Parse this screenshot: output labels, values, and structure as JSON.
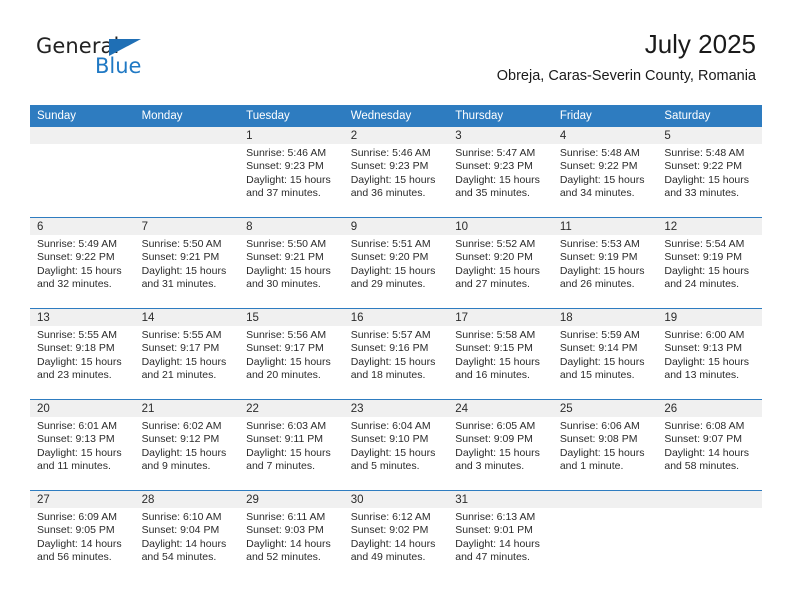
{
  "brand": {
    "name_top": "General",
    "name_bottom": "Blue",
    "triangle_icon": "triangle-icon",
    "color_blue": "#2079c4",
    "color_dark": "#222222"
  },
  "header": {
    "title": "July 2025",
    "subtitle": "Obreja, Caras-Severin County, Romania"
  },
  "theme": {
    "header_blue": "#2e7cc0",
    "daynum_band": "#f0f0f0",
    "text": "#2b2b2b"
  },
  "weekdays": [
    "Sunday",
    "Monday",
    "Tuesday",
    "Wednesday",
    "Thursday",
    "Friday",
    "Saturday"
  ],
  "weeks": [
    [
      {
        "day": "",
        "sunrise": "",
        "sunset": "",
        "daylight": ""
      },
      {
        "day": "",
        "sunrise": "",
        "sunset": "",
        "daylight": ""
      },
      {
        "day": "1",
        "sunrise": "Sunrise: 5:46 AM",
        "sunset": "Sunset: 9:23 PM",
        "daylight": "Daylight: 15 hours and 37 minutes."
      },
      {
        "day": "2",
        "sunrise": "Sunrise: 5:46 AM",
        "sunset": "Sunset: 9:23 PM",
        "daylight": "Daylight: 15 hours and 36 minutes."
      },
      {
        "day": "3",
        "sunrise": "Sunrise: 5:47 AM",
        "sunset": "Sunset: 9:23 PM",
        "daylight": "Daylight: 15 hours and 35 minutes."
      },
      {
        "day": "4",
        "sunrise": "Sunrise: 5:48 AM",
        "sunset": "Sunset: 9:22 PM",
        "daylight": "Daylight: 15 hours and 34 minutes."
      },
      {
        "day": "5",
        "sunrise": "Sunrise: 5:48 AM",
        "sunset": "Sunset: 9:22 PM",
        "daylight": "Daylight: 15 hours and 33 minutes."
      }
    ],
    [
      {
        "day": "6",
        "sunrise": "Sunrise: 5:49 AM",
        "sunset": "Sunset: 9:22 PM",
        "daylight": "Daylight: 15 hours and 32 minutes."
      },
      {
        "day": "7",
        "sunrise": "Sunrise: 5:50 AM",
        "sunset": "Sunset: 9:21 PM",
        "daylight": "Daylight: 15 hours and 31 minutes."
      },
      {
        "day": "8",
        "sunrise": "Sunrise: 5:50 AM",
        "sunset": "Sunset: 9:21 PM",
        "daylight": "Daylight: 15 hours and 30 minutes."
      },
      {
        "day": "9",
        "sunrise": "Sunrise: 5:51 AM",
        "sunset": "Sunset: 9:20 PM",
        "daylight": "Daylight: 15 hours and 29 minutes."
      },
      {
        "day": "10",
        "sunrise": "Sunrise: 5:52 AM",
        "sunset": "Sunset: 9:20 PM",
        "daylight": "Daylight: 15 hours and 27 minutes."
      },
      {
        "day": "11",
        "sunrise": "Sunrise: 5:53 AM",
        "sunset": "Sunset: 9:19 PM",
        "daylight": "Daylight: 15 hours and 26 minutes."
      },
      {
        "day": "12",
        "sunrise": "Sunrise: 5:54 AM",
        "sunset": "Sunset: 9:19 PM",
        "daylight": "Daylight: 15 hours and 24 minutes."
      }
    ],
    [
      {
        "day": "13",
        "sunrise": "Sunrise: 5:55 AM",
        "sunset": "Sunset: 9:18 PM",
        "daylight": "Daylight: 15 hours and 23 minutes."
      },
      {
        "day": "14",
        "sunrise": "Sunrise: 5:55 AM",
        "sunset": "Sunset: 9:17 PM",
        "daylight": "Daylight: 15 hours and 21 minutes."
      },
      {
        "day": "15",
        "sunrise": "Sunrise: 5:56 AM",
        "sunset": "Sunset: 9:17 PM",
        "daylight": "Daylight: 15 hours and 20 minutes."
      },
      {
        "day": "16",
        "sunrise": "Sunrise: 5:57 AM",
        "sunset": "Sunset: 9:16 PM",
        "daylight": "Daylight: 15 hours and 18 minutes."
      },
      {
        "day": "17",
        "sunrise": "Sunrise: 5:58 AM",
        "sunset": "Sunset: 9:15 PM",
        "daylight": "Daylight: 15 hours and 16 minutes."
      },
      {
        "day": "18",
        "sunrise": "Sunrise: 5:59 AM",
        "sunset": "Sunset: 9:14 PM",
        "daylight": "Daylight: 15 hours and 15 minutes."
      },
      {
        "day": "19",
        "sunrise": "Sunrise: 6:00 AM",
        "sunset": "Sunset: 9:13 PM",
        "daylight": "Daylight: 15 hours and 13 minutes."
      }
    ],
    [
      {
        "day": "20",
        "sunrise": "Sunrise: 6:01 AM",
        "sunset": "Sunset: 9:13 PM",
        "daylight": "Daylight: 15 hours and 11 minutes."
      },
      {
        "day": "21",
        "sunrise": "Sunrise: 6:02 AM",
        "sunset": "Sunset: 9:12 PM",
        "daylight": "Daylight: 15 hours and 9 minutes."
      },
      {
        "day": "22",
        "sunrise": "Sunrise: 6:03 AM",
        "sunset": "Sunset: 9:11 PM",
        "daylight": "Daylight: 15 hours and 7 minutes."
      },
      {
        "day": "23",
        "sunrise": "Sunrise: 6:04 AM",
        "sunset": "Sunset: 9:10 PM",
        "daylight": "Daylight: 15 hours and 5 minutes."
      },
      {
        "day": "24",
        "sunrise": "Sunrise: 6:05 AM",
        "sunset": "Sunset: 9:09 PM",
        "daylight": "Daylight: 15 hours and 3 minutes."
      },
      {
        "day": "25",
        "sunrise": "Sunrise: 6:06 AM",
        "sunset": "Sunset: 9:08 PM",
        "daylight": "Daylight: 15 hours and 1 minute."
      },
      {
        "day": "26",
        "sunrise": "Sunrise: 6:08 AM",
        "sunset": "Sunset: 9:07 PM",
        "daylight": "Daylight: 14 hours and 58 minutes."
      }
    ],
    [
      {
        "day": "27",
        "sunrise": "Sunrise: 6:09 AM",
        "sunset": "Sunset: 9:05 PM",
        "daylight": "Daylight: 14 hours and 56 minutes."
      },
      {
        "day": "28",
        "sunrise": "Sunrise: 6:10 AM",
        "sunset": "Sunset: 9:04 PM",
        "daylight": "Daylight: 14 hours and 54 minutes."
      },
      {
        "day": "29",
        "sunrise": "Sunrise: 6:11 AM",
        "sunset": "Sunset: 9:03 PM",
        "daylight": "Daylight: 14 hours and 52 minutes."
      },
      {
        "day": "30",
        "sunrise": "Sunrise: 6:12 AM",
        "sunset": "Sunset: 9:02 PM",
        "daylight": "Daylight: 14 hours and 49 minutes."
      },
      {
        "day": "31",
        "sunrise": "Sunrise: 6:13 AM",
        "sunset": "Sunset: 9:01 PM",
        "daylight": "Daylight: 14 hours and 47 minutes."
      },
      {
        "day": "",
        "sunrise": "",
        "sunset": "",
        "daylight": ""
      },
      {
        "day": "",
        "sunrise": "",
        "sunset": "",
        "daylight": ""
      }
    ]
  ]
}
